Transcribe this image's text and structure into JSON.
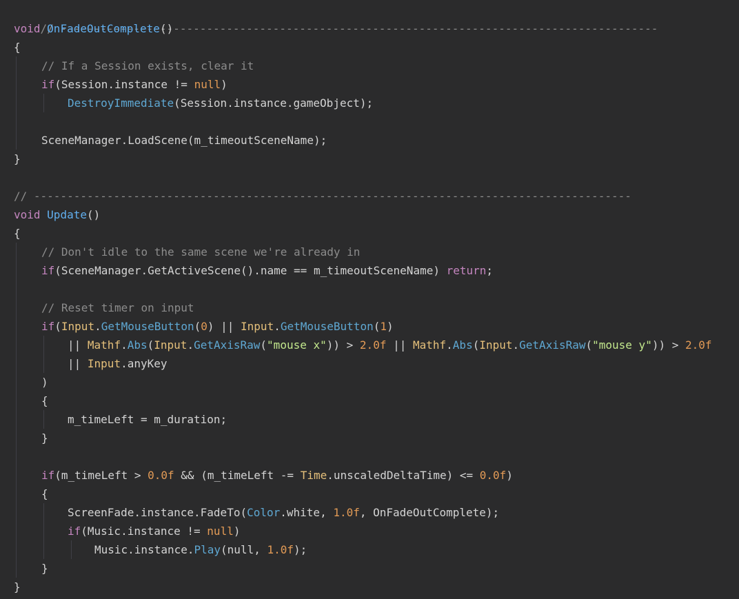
{
  "theme": {
    "background": "#2b2b2c",
    "comment": "#8c8c8c",
    "keyword": "#c586c0",
    "function": "#61afef",
    "type": "#e5c07b",
    "number": "#e39b56",
    "string": "#c3e88d"
  },
  "code": {
    "l1_comment": "// ------------------------------------------------------------------------------------------",
    "l2_kw": "void ",
    "l2_fn": "OnFadeOutComplete",
    "l2_rest": "()",
    "l3": "{",
    "l4_comment": "// If a Session exists, clear it",
    "l5_kw": "if",
    "l5_a": "(Session.instance != ",
    "l5_null": "null",
    "l5_b": ")",
    "l6_fn": "DestroyImmediate",
    "l6_rest": "(Session.instance.gameObject);",
    "l8": "SceneManager.LoadScene(m_timeoutSceneName);",
    "l9": "}",
    "l11_comment": "// ------------------------------------------------------------------------------------------",
    "l12_kw": "void ",
    "l12_fn": "Update",
    "l12_rest": "()",
    "l13": "{",
    "l14_comment": "// Don't idle to the same scene we're already in",
    "l15_kw": "if",
    "l15_a": "(SceneManager.GetActiveScene().name == m_timeoutSceneName) ",
    "l15_ret": "return",
    "l15_b": ";",
    "l17_comment": "// Reset timer on input",
    "l18_kw": "if",
    "l18_p1": "(",
    "l18_t1": "Input",
    "l18_d1": ".",
    "l18_m1": "GetMouseButton",
    "l18_p2": "(",
    "l18_n1": "0",
    "l18_p3": ") || ",
    "l18_t2": "Input",
    "l18_d2": ".",
    "l18_m2": "GetMouseButton",
    "l18_p4": "(",
    "l18_n2": "1",
    "l18_p5": ")",
    "l19_a": "|| ",
    "l19_t1": "Mathf",
    "l19_d1": ".",
    "l19_m1": "Abs",
    "l19_p1": "(",
    "l19_t2": "Input",
    "l19_d2": ".",
    "l19_m2": "GetAxisRaw",
    "l19_p2": "(",
    "l19_s1": "\"mouse x\"",
    "l19_p3": ")) > ",
    "l19_n1": "2.0f",
    "l19_p4": " || ",
    "l19_t3": "Mathf",
    "l19_d3": ".",
    "l19_m3": "Abs",
    "l19_p5": "(",
    "l19_t4": "Input",
    "l19_d4": ".",
    "l19_m4": "GetAxisRaw",
    "l19_p6": "(",
    "l19_s2": "\"mouse y\"",
    "l19_p7": ")) > ",
    "l19_n2": "2.0f",
    "l20_a": "|| ",
    "l20_t": "Input",
    "l20_b": ".anyKey",
    "l21": ")",
    "l22": "{",
    "l23": "m_timeLeft = m_duration;",
    "l24": "}",
    "l26_kw": "if",
    "l26_a": "(m_timeLeft > ",
    "l26_n1": "0.0f",
    "l26_b": " && (m_timeLeft -= ",
    "l26_t": "Time",
    "l26_c": ".unscaledDeltaTime) <= ",
    "l26_n2": "0.0f",
    "l26_d": ")",
    "l27": "{",
    "l28_a": "ScreenFade.instance.FadeTo(",
    "l28_t": "Color",
    "l28_b": ".white, ",
    "l28_n": "1.0f",
    "l28_c": ", OnFadeOutComplete);",
    "l29_kw": "if",
    "l29_a": "(Music.instance != ",
    "l29_null": "null",
    "l29_b": ")",
    "l30_a": "Music.instance.",
    "l30_fn": "Play",
    "l30_b": "(",
    "l30_null": "null",
    "l30_c": ", ",
    "l30_n": "1.0f",
    "l30_d": ");",
    "l31": "}",
    "l32": "}"
  }
}
